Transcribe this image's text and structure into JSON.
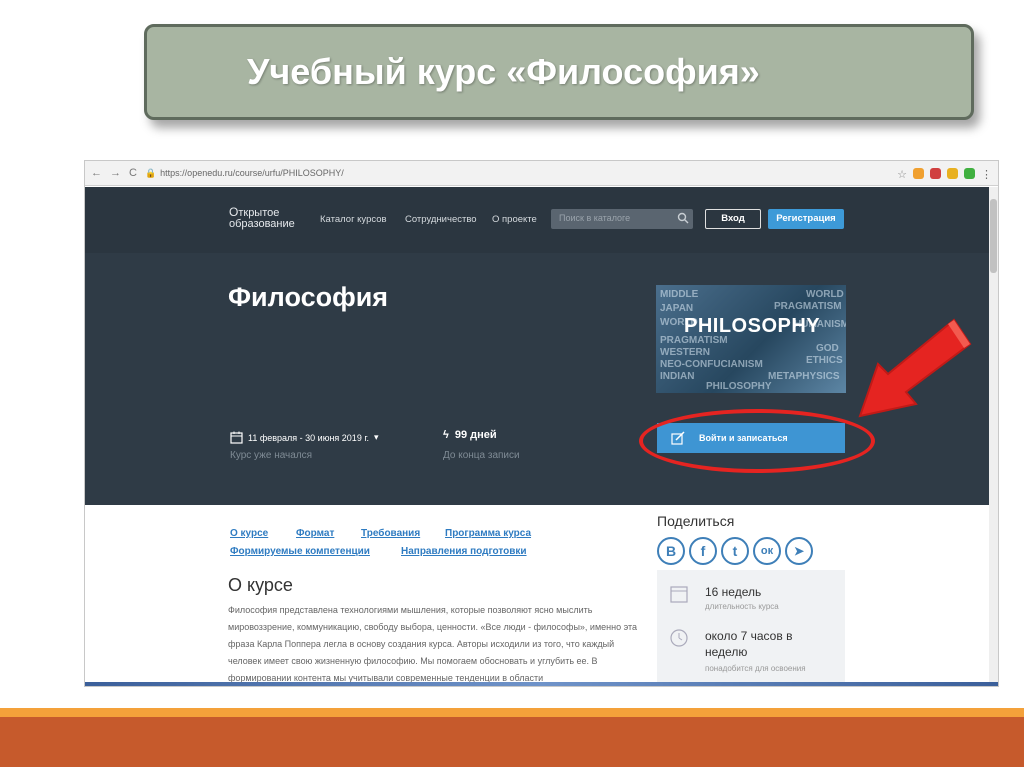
{
  "slide": {
    "title": "Учебный курс «Философия»"
  },
  "browser": {
    "url": "https://openedu.ru/course/urfu/PHILOSOPHY/"
  },
  "site": {
    "logo_line1": "ткрытое",
    "logo_line2": "образование",
    "menu": [
      "Каталог курсов",
      "Сотрудничество",
      "О проекте"
    ],
    "search_placeholder": "Поиск в каталоге",
    "login_label": "Вход",
    "register_label": "Регистрация"
  },
  "course": {
    "title": "Философия",
    "image_main_word": "PHILOSOPHY",
    "image_words": [
      "MIDDLE",
      "WORLD",
      "JAPAN",
      "PRAGMATISM",
      "WORLD",
      "HUMANISM",
      "PRAGMATISM",
      "WESTERN",
      "GOD",
      "NEO-CONFUCIANISM",
      "ETHICS",
      "INDIAN",
      "PHILOSOPHY",
      "METAPHYSICS"
    ],
    "dates": "11 февраля - 30 июня 2019 г.",
    "status": "Курс уже начался",
    "days_left": "99 дней",
    "days_caption": "До конца записи",
    "enroll_label": "Войти и записаться"
  },
  "tabs": {
    "row1": [
      "О курсе",
      "Формат",
      "Требования",
      "Программа курса"
    ],
    "row2": [
      "Формируемые компетенции",
      "Направления подготовки"
    ]
  },
  "about": {
    "heading": "О курсе",
    "text": "Философия представлена технологиями мышления, которые позволяют ясно мыслить мировоззрение, коммуникацию, свободу выбора, ценности. «Все люди - философы», именно эта фраза Карла Поппера легла в основу создания курса. Авторы исходили из того, что каждый человек имеет свою жизненную философию. Мы помогаем обосновать и углубить ее. В формировании контента мы учитывали современные тенденции в области"
  },
  "share": {
    "heading": "Поделиться",
    "icons": [
      "В",
      "f",
      "t",
      "ок",
      "➤"
    ]
  },
  "stats": {
    "duration_value": "16 недель",
    "duration_label": "длительность курса",
    "load_value": "около 7 часов в неделю",
    "load_label": "понадобится для освоения"
  },
  "colors": {
    "banner": "#a8b5a2",
    "hero": "#2f3b46",
    "accent": "#3e95d3",
    "highlight_red": "#e52421",
    "stripe_orange": "#f4a13a",
    "stripe_rust": "#c65a2c"
  }
}
